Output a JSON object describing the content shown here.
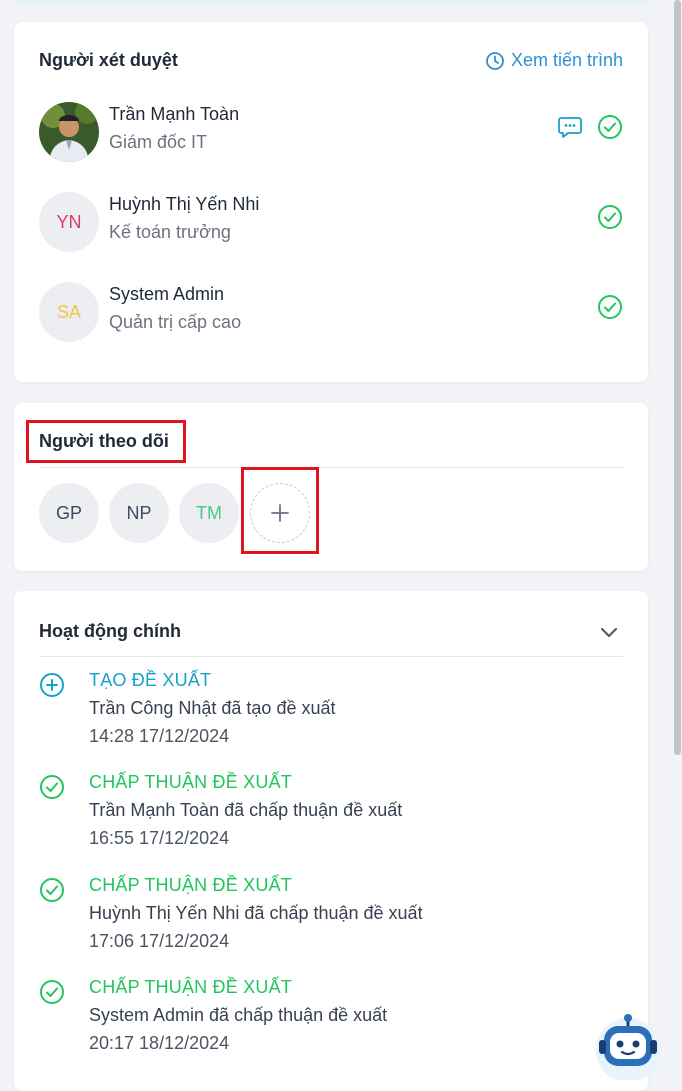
{
  "colors": {
    "link": "#2f8fd3",
    "approve": "#22c55e",
    "create": "#16a3c9",
    "highlight": "#e0141e"
  },
  "reviewers": {
    "title": "Người xét duyệt",
    "timeline_link": "Xem tiến trình",
    "items": [
      {
        "name": "Trần Mạnh Toàn",
        "role": "Giám đốc IT",
        "avatar": "photo",
        "has_comment": true,
        "approved": true
      },
      {
        "name": "Huỳnh Thị Yến Nhi",
        "role": "Kế toán trưởng",
        "initials": "YN",
        "initials_color": "#d43f6a",
        "approved": true
      },
      {
        "name": "System Admin",
        "role": "Quản trị cấp cao",
        "initials": "SA",
        "initials_color": "#f4c542",
        "approved": true
      }
    ]
  },
  "followers": {
    "title": "Người theo dõi",
    "items": [
      {
        "initials": "GP",
        "color": "#3f4a5e"
      },
      {
        "initials": "NP",
        "color": "#3f4a5e"
      },
      {
        "initials": "TM",
        "color": "#4cc78a"
      }
    ],
    "add_icon": "plus-icon"
  },
  "activities": {
    "title": "Hoạt động chính",
    "items": [
      {
        "type": "create",
        "title": "TẠO ĐỀ XUẤT",
        "desc": "Trần Công Nhật đã tạo đề xuất",
        "time": "14:28 17/12/2024"
      },
      {
        "type": "approve",
        "title": "CHẤP THUẬN ĐỀ XUẤT",
        "desc": "Trần Mạnh Toàn đã chấp thuận đề xuất",
        "time": "16:55 17/12/2024"
      },
      {
        "type": "approve",
        "title": "CHẤP THUẬN ĐỀ XUẤT",
        "desc": "Huỳnh Thị Yến Nhi đã chấp thuận đề xuất",
        "time": "17:06 17/12/2024"
      },
      {
        "type": "approve",
        "title": "CHẤP THUẬN ĐỀ XUẤT",
        "desc": "System Admin đã chấp thuận đề xuất",
        "time": "20:17 18/12/2024"
      }
    ]
  },
  "assistant": {
    "icon": "chatbot-icon"
  }
}
